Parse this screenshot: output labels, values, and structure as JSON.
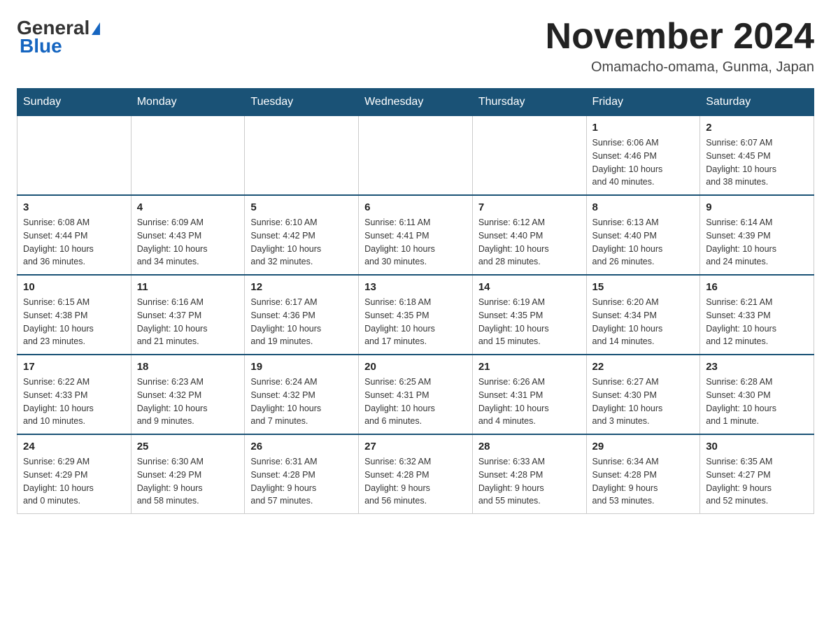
{
  "header": {
    "logo_general": "General",
    "logo_blue": "Blue",
    "title": "November 2024",
    "location": "Omamacho-omama, Gunma, Japan"
  },
  "days_of_week": [
    "Sunday",
    "Monday",
    "Tuesday",
    "Wednesday",
    "Thursday",
    "Friday",
    "Saturday"
  ],
  "weeks": [
    [
      {
        "day": "",
        "info": ""
      },
      {
        "day": "",
        "info": ""
      },
      {
        "day": "",
        "info": ""
      },
      {
        "day": "",
        "info": ""
      },
      {
        "day": "",
        "info": ""
      },
      {
        "day": "1",
        "info": "Sunrise: 6:06 AM\nSunset: 4:46 PM\nDaylight: 10 hours\nand 40 minutes."
      },
      {
        "day": "2",
        "info": "Sunrise: 6:07 AM\nSunset: 4:45 PM\nDaylight: 10 hours\nand 38 minutes."
      }
    ],
    [
      {
        "day": "3",
        "info": "Sunrise: 6:08 AM\nSunset: 4:44 PM\nDaylight: 10 hours\nand 36 minutes."
      },
      {
        "day": "4",
        "info": "Sunrise: 6:09 AM\nSunset: 4:43 PM\nDaylight: 10 hours\nand 34 minutes."
      },
      {
        "day": "5",
        "info": "Sunrise: 6:10 AM\nSunset: 4:42 PM\nDaylight: 10 hours\nand 32 minutes."
      },
      {
        "day": "6",
        "info": "Sunrise: 6:11 AM\nSunset: 4:41 PM\nDaylight: 10 hours\nand 30 minutes."
      },
      {
        "day": "7",
        "info": "Sunrise: 6:12 AM\nSunset: 4:40 PM\nDaylight: 10 hours\nand 28 minutes."
      },
      {
        "day": "8",
        "info": "Sunrise: 6:13 AM\nSunset: 4:40 PM\nDaylight: 10 hours\nand 26 minutes."
      },
      {
        "day": "9",
        "info": "Sunrise: 6:14 AM\nSunset: 4:39 PM\nDaylight: 10 hours\nand 24 minutes."
      }
    ],
    [
      {
        "day": "10",
        "info": "Sunrise: 6:15 AM\nSunset: 4:38 PM\nDaylight: 10 hours\nand 23 minutes."
      },
      {
        "day": "11",
        "info": "Sunrise: 6:16 AM\nSunset: 4:37 PM\nDaylight: 10 hours\nand 21 minutes."
      },
      {
        "day": "12",
        "info": "Sunrise: 6:17 AM\nSunset: 4:36 PM\nDaylight: 10 hours\nand 19 minutes."
      },
      {
        "day": "13",
        "info": "Sunrise: 6:18 AM\nSunset: 4:35 PM\nDaylight: 10 hours\nand 17 minutes."
      },
      {
        "day": "14",
        "info": "Sunrise: 6:19 AM\nSunset: 4:35 PM\nDaylight: 10 hours\nand 15 minutes."
      },
      {
        "day": "15",
        "info": "Sunrise: 6:20 AM\nSunset: 4:34 PM\nDaylight: 10 hours\nand 14 minutes."
      },
      {
        "day": "16",
        "info": "Sunrise: 6:21 AM\nSunset: 4:33 PM\nDaylight: 10 hours\nand 12 minutes."
      }
    ],
    [
      {
        "day": "17",
        "info": "Sunrise: 6:22 AM\nSunset: 4:33 PM\nDaylight: 10 hours\nand 10 minutes."
      },
      {
        "day": "18",
        "info": "Sunrise: 6:23 AM\nSunset: 4:32 PM\nDaylight: 10 hours\nand 9 minutes."
      },
      {
        "day": "19",
        "info": "Sunrise: 6:24 AM\nSunset: 4:32 PM\nDaylight: 10 hours\nand 7 minutes."
      },
      {
        "day": "20",
        "info": "Sunrise: 6:25 AM\nSunset: 4:31 PM\nDaylight: 10 hours\nand 6 minutes."
      },
      {
        "day": "21",
        "info": "Sunrise: 6:26 AM\nSunset: 4:31 PM\nDaylight: 10 hours\nand 4 minutes."
      },
      {
        "day": "22",
        "info": "Sunrise: 6:27 AM\nSunset: 4:30 PM\nDaylight: 10 hours\nand 3 minutes."
      },
      {
        "day": "23",
        "info": "Sunrise: 6:28 AM\nSunset: 4:30 PM\nDaylight: 10 hours\nand 1 minute."
      }
    ],
    [
      {
        "day": "24",
        "info": "Sunrise: 6:29 AM\nSunset: 4:29 PM\nDaylight: 10 hours\nand 0 minutes."
      },
      {
        "day": "25",
        "info": "Sunrise: 6:30 AM\nSunset: 4:29 PM\nDaylight: 9 hours\nand 58 minutes."
      },
      {
        "day": "26",
        "info": "Sunrise: 6:31 AM\nSunset: 4:28 PM\nDaylight: 9 hours\nand 57 minutes."
      },
      {
        "day": "27",
        "info": "Sunrise: 6:32 AM\nSunset: 4:28 PM\nDaylight: 9 hours\nand 56 minutes."
      },
      {
        "day": "28",
        "info": "Sunrise: 6:33 AM\nSunset: 4:28 PM\nDaylight: 9 hours\nand 55 minutes."
      },
      {
        "day": "29",
        "info": "Sunrise: 6:34 AM\nSunset: 4:28 PM\nDaylight: 9 hours\nand 53 minutes."
      },
      {
        "day": "30",
        "info": "Sunrise: 6:35 AM\nSunset: 4:27 PM\nDaylight: 9 hours\nand 52 minutes."
      }
    ]
  ]
}
